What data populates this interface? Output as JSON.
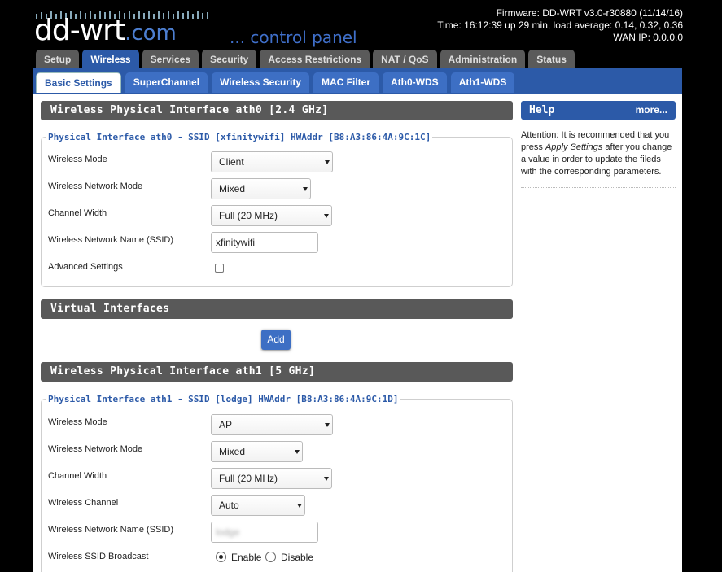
{
  "header": {
    "logo_main": "dd-wrt",
    "logo_suffix": ".com",
    "tagline": "... control panel",
    "firmware": "Firmware: DD-WRT v3.0-r30880 (11/14/16)",
    "time": "Time: 16:12:39 up 29 min, load average: 0.14, 0.32, 0.36",
    "wan_ip": "WAN IP: 0.0.0.0"
  },
  "main_tabs": [
    "Setup",
    "Wireless",
    "Services",
    "Security",
    "Access Restrictions",
    "NAT / QoS",
    "Administration",
    "Status"
  ],
  "sub_tabs": [
    "Basic Settings",
    "SuperChannel",
    "Wireless Security",
    "MAC Filter",
    "Ath0-WDS",
    "Ath1-WDS"
  ],
  "ath0": {
    "section_title": "Wireless Physical Interface ath0 [2.4 GHz]",
    "legend": "Physical Interface ath0 - SSID [xfinitywifi] HWAddr [B8:A3:86:4A:9C:1C]",
    "wireless_mode_label": "Wireless Mode",
    "wireless_mode": "Client",
    "network_mode_label": "Wireless Network Mode",
    "network_mode": "Mixed",
    "channel_width_label": "Channel Width",
    "channel_width": "Full (20 MHz)",
    "ssid_label": "Wireless Network Name (SSID)",
    "ssid": "xfinitywifi",
    "advanced_label": "Advanced Settings"
  },
  "virtual": {
    "section_title": "Virtual Interfaces",
    "add_label": "Add"
  },
  "ath1": {
    "section_title": "Wireless Physical Interface ath1 [5 GHz]",
    "legend": "Physical Interface ath1 - SSID [lodge] HWAddr [B8:A3:86:4A:9C:1D]",
    "wireless_mode_label": "Wireless Mode",
    "wireless_mode": "AP",
    "network_mode_label": "Wireless Network Mode",
    "network_mode": "Mixed",
    "channel_width_label": "Channel Width",
    "channel_width": "Full (20 MHz)",
    "channel_label": "Wireless Channel",
    "channel": "Auto",
    "ssid_label": "Wireless Network Name (SSID)",
    "ssid": "lodge",
    "broadcast_label": "Wireless SSID Broadcast",
    "enable_label": "Enable",
    "disable_label": "Disable"
  },
  "help": {
    "title": "Help",
    "more": "more...",
    "text_before": "Attention: It is recommended that you press ",
    "text_em": "Apply Settings",
    "text_after": " after you change a value in order to update the fileds with the corresponding parameters."
  }
}
